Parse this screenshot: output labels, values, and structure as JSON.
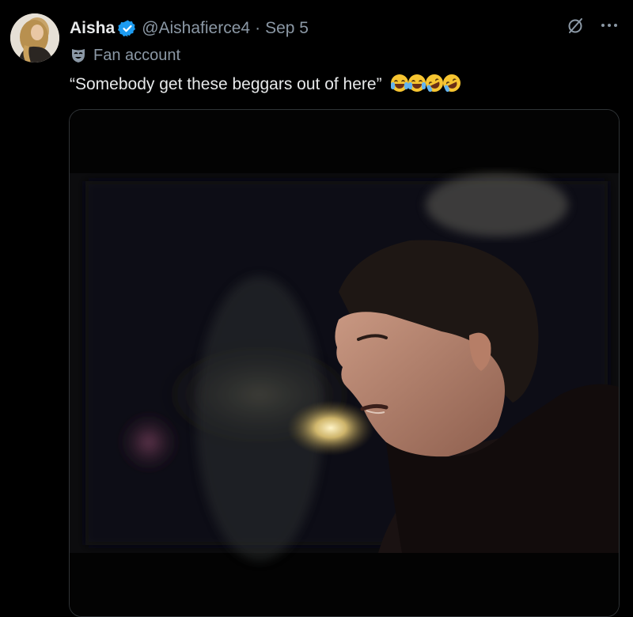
{
  "tweet": {
    "author": {
      "display_name": "Aisha",
      "handle": "@Aishafierce4",
      "verified": true,
      "avatar_icon": "avatar-photo"
    },
    "separator": "·",
    "date": "Sep 5",
    "account_label": {
      "icon": "theater-mask-icon",
      "text": "Fan account"
    },
    "text": "“Somebody get these beggars out of here”",
    "emojis": [
      "loudly-crying-face",
      "loudly-crying-face",
      "rolling-on-floor-laughing",
      "rolling-on-floor-laughing"
    ],
    "actions": {
      "grok_icon": "grok-icon",
      "more_icon": "more-dots-icon",
      "more_label": "···"
    },
    "media": {
      "type": "video",
      "description_icon": "video-frame"
    }
  },
  "colors": {
    "background": "#000000",
    "text_primary": "#e7e9ea",
    "text_secondary": "#8b98a5",
    "verified_blue": "#1d9bf0",
    "media_border": "#2f3336"
  }
}
